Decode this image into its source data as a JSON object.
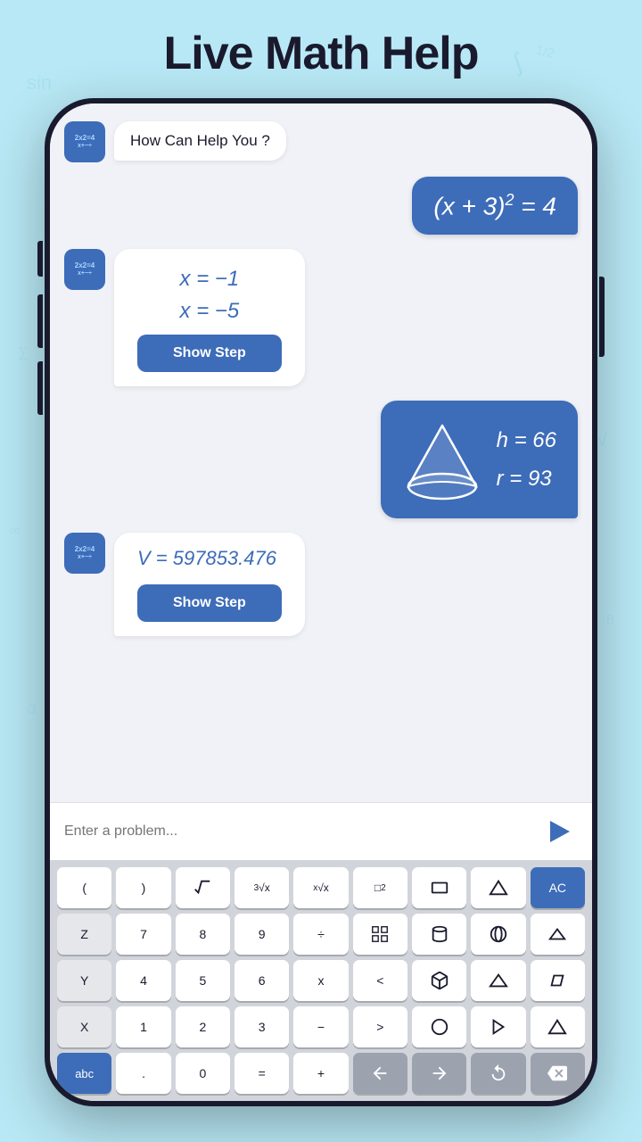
{
  "app_title": "Live Math Help",
  "greeting": "How Can Help You ?",
  "messages": [
    {
      "type": "user",
      "content_type": "equation",
      "equation": "(x + 3)² = 4"
    },
    {
      "type": "bot",
      "content_type": "solution",
      "lines": [
        "x = −1",
        "x = −5"
      ],
      "button_label": "Show Step"
    },
    {
      "type": "user",
      "content_type": "cone",
      "h_value": "h = 66",
      "r_value": "r = 93"
    },
    {
      "type": "bot",
      "content_type": "volume",
      "equation": "V = 597853.476",
      "button_label": "Show Step"
    }
  ],
  "input_placeholder": "Enter a problem...",
  "keyboard": {
    "row1": [
      "(",
      ")",
      "√x",
      "³√x",
      "ˣ√x",
      "□²",
      "□",
      "△",
      "AC"
    ],
    "row2": [
      "Z",
      "7",
      "8",
      "9",
      "÷",
      "⊞",
      "⊙",
      "⊖",
      "△"
    ],
    "row3": [
      "Y",
      "4",
      "5",
      "6",
      "x",
      "<",
      "⬡",
      "△",
      "▱"
    ],
    "row4": [
      "X",
      "1",
      "2",
      "3",
      "-",
      ">",
      "○",
      "▷",
      "△"
    ],
    "row5": [
      "abc",
      ".",
      "0",
      "=",
      "+",
      "←",
      "→",
      "↺",
      "✕"
    ]
  },
  "bot_avatar": {
    "line1": "2x2=4",
    "line2": "x+−÷"
  },
  "colors": {
    "accent": "#3d6cb9",
    "bg": "#b8e8f5",
    "phone_bg": "#f0f2f7"
  }
}
